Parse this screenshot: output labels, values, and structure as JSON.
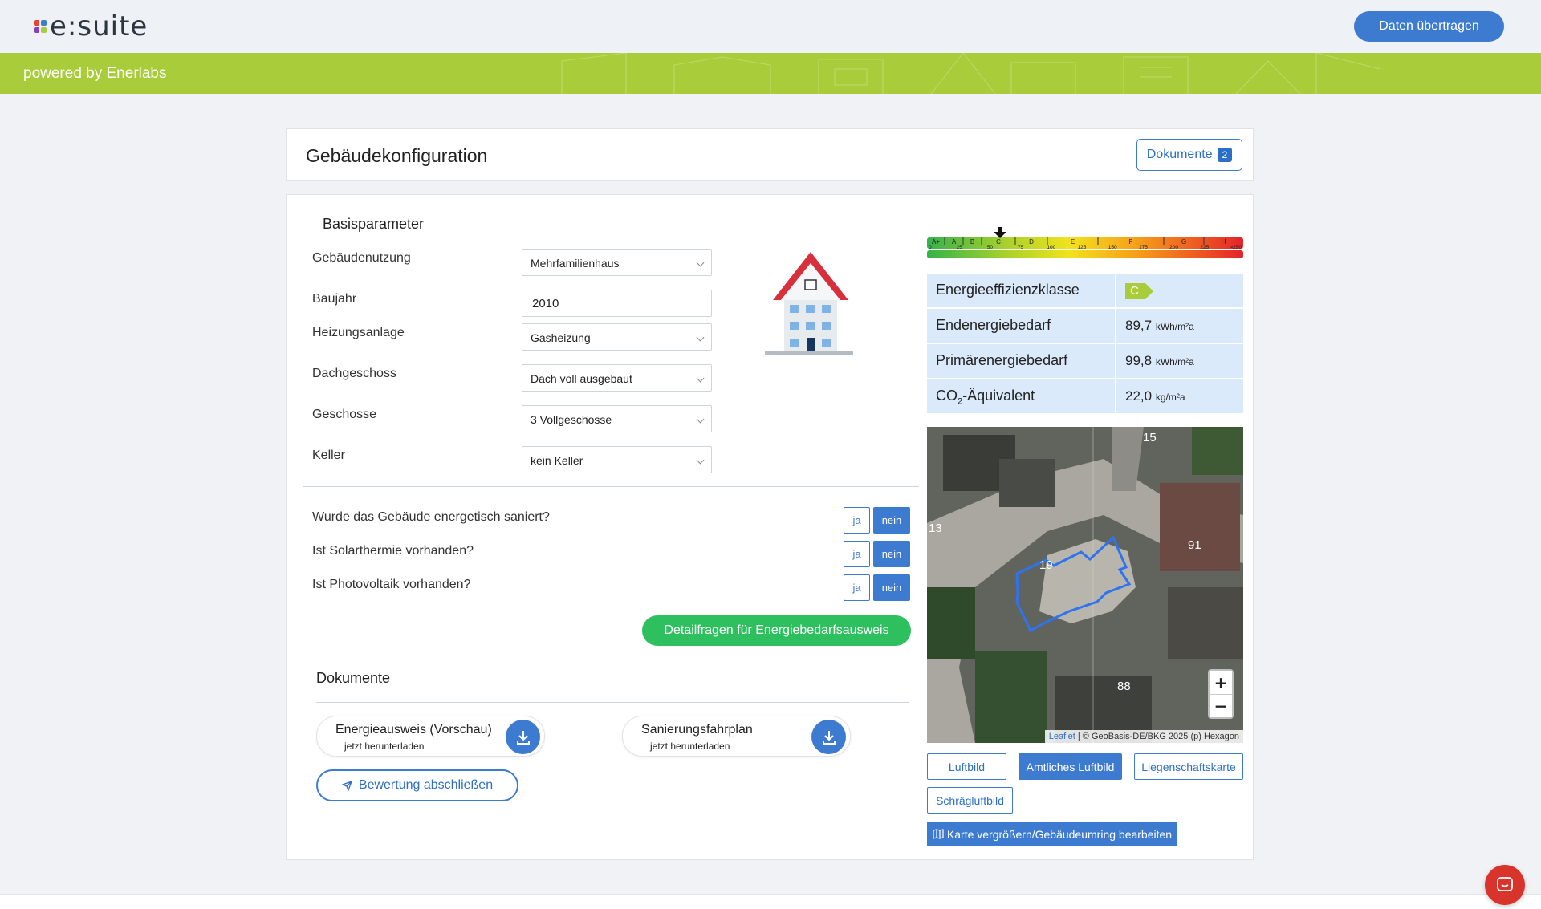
{
  "header": {
    "logo_text": "e:suite",
    "transfer_button": "Daten übertragen",
    "powered_by": "powered by Enerlabs"
  },
  "title_card": {
    "title": "Gebäudekonfiguration",
    "docs_button": "Dokumente",
    "docs_count": "2"
  },
  "basis": {
    "heading": "Basisparameter",
    "fields": [
      {
        "label": "Gebäudenutzung",
        "value": "Mehrfamilienhaus"
      },
      {
        "label": "Baujahr",
        "value": "2010"
      },
      {
        "label": "Heizungsanlage",
        "value": "Gasheizung"
      },
      {
        "label": "Dachgeschoss",
        "value": "Dach voll ausgebaut"
      },
      {
        "label": "Geschosse",
        "value": "3 Vollgeschosse"
      },
      {
        "label": "Keller",
        "value": "kein Keller"
      }
    ]
  },
  "questions": [
    {
      "label": "Wurde das Gebäude energetisch saniert?",
      "yes": "ja",
      "no": "nein"
    },
    {
      "label": "Ist Solarthermie vorhanden?",
      "yes": "ja",
      "no": "nein"
    },
    {
      "label": "Ist Photovoltaik vorhanden?",
      "yes": "ja",
      "no": "nein"
    }
  ],
  "detail_button": "Detailfragen für Energiebedarfsausweis",
  "documents": {
    "heading": "Dokumente",
    "items": [
      {
        "title": "Energieausweis (Vorschau)",
        "subtitle": "jetzt herunterladen"
      },
      {
        "title": "Sanierungsfahrplan",
        "subtitle": "jetzt herunterladen"
      }
    ],
    "finish_button": "Bewertung abschließen"
  },
  "energy_scale": {
    "classes": [
      "A+",
      "A",
      "B",
      "C",
      "D",
      "E",
      "F",
      "G",
      "H"
    ],
    "ticks": [
      "0",
      "25",
      "50",
      "75",
      "100",
      "125",
      "150",
      "175",
      "200",
      "225",
      ">250"
    ],
    "current_class": "C",
    "marker_value": 89.7
  },
  "energy_info": {
    "class_label": "Energieeffizienzklasse",
    "class_value": "C",
    "end_label": "Endenergiebedarf",
    "end_value": "89,7",
    "end_unit": "kWh/m²a",
    "primary_label": "Primärenergiebedarf",
    "primary_value": "99,8",
    "primary_unit": "kWh/m²a",
    "co2_label_pre": "CO",
    "co2_label_sub": "2",
    "co2_label_post": "-Äquivalent",
    "co2_value": "22,0",
    "co2_unit": "kg/m²a"
  },
  "map": {
    "labels": [
      "15",
      "13",
      "19",
      "91",
      "88"
    ],
    "zoom_in": "+",
    "zoom_out": "−",
    "attr_leaflet": "Leaflet",
    "attr_rest": " | © GeoBasis-DE/BKG 2025 (p) Hexagon",
    "buttons": [
      "Luftbild",
      "Amtliches Luftbild",
      "Liegenschaftskarte",
      "Schrägluftbild"
    ],
    "active_button": "Amtliches Luftbild",
    "edit_button": "Karte vergrößern/Gebäudeumring bearbeiten"
  },
  "colors": {
    "accent": "#3d7bd0",
    "brand_green": "#a9cc3a",
    "action_green": "#2ec05f",
    "chat_red": "#d9342b"
  }
}
